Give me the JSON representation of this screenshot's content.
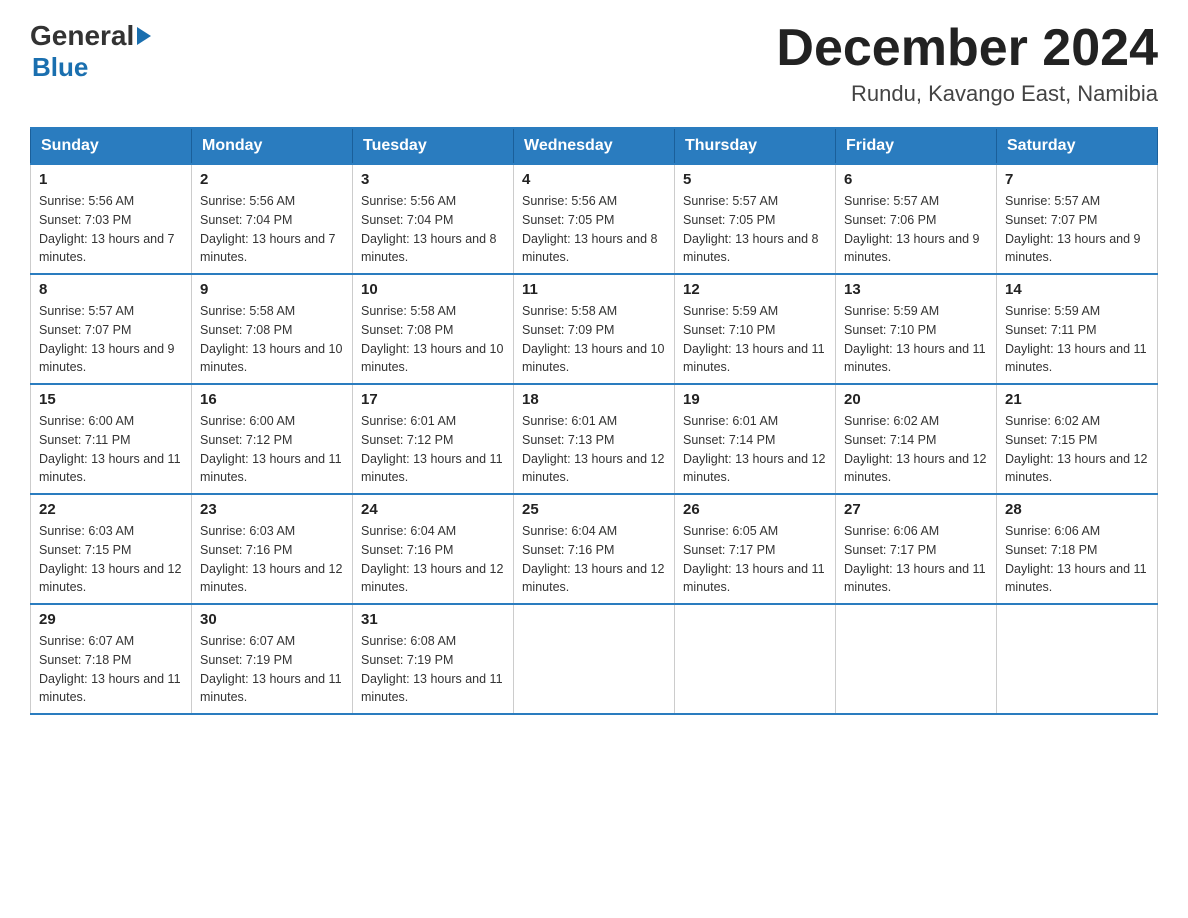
{
  "logo": {
    "general": "General",
    "blue": "Blue"
  },
  "title": {
    "month_year": "December 2024",
    "location": "Rundu, Kavango East, Namibia"
  },
  "weekdays": [
    "Sunday",
    "Monday",
    "Tuesday",
    "Wednesday",
    "Thursday",
    "Friday",
    "Saturday"
  ],
  "weeks": [
    [
      {
        "day": "1",
        "sunrise": "Sunrise: 5:56 AM",
        "sunset": "Sunset: 7:03 PM",
        "daylight": "Daylight: 13 hours and 7 minutes."
      },
      {
        "day": "2",
        "sunrise": "Sunrise: 5:56 AM",
        "sunset": "Sunset: 7:04 PM",
        "daylight": "Daylight: 13 hours and 7 minutes."
      },
      {
        "day": "3",
        "sunrise": "Sunrise: 5:56 AM",
        "sunset": "Sunset: 7:04 PM",
        "daylight": "Daylight: 13 hours and 8 minutes."
      },
      {
        "day": "4",
        "sunrise": "Sunrise: 5:56 AM",
        "sunset": "Sunset: 7:05 PM",
        "daylight": "Daylight: 13 hours and 8 minutes."
      },
      {
        "day": "5",
        "sunrise": "Sunrise: 5:57 AM",
        "sunset": "Sunset: 7:05 PM",
        "daylight": "Daylight: 13 hours and 8 minutes."
      },
      {
        "day": "6",
        "sunrise": "Sunrise: 5:57 AM",
        "sunset": "Sunset: 7:06 PM",
        "daylight": "Daylight: 13 hours and 9 minutes."
      },
      {
        "day": "7",
        "sunrise": "Sunrise: 5:57 AM",
        "sunset": "Sunset: 7:07 PM",
        "daylight": "Daylight: 13 hours and 9 minutes."
      }
    ],
    [
      {
        "day": "8",
        "sunrise": "Sunrise: 5:57 AM",
        "sunset": "Sunset: 7:07 PM",
        "daylight": "Daylight: 13 hours and 9 minutes."
      },
      {
        "day": "9",
        "sunrise": "Sunrise: 5:58 AM",
        "sunset": "Sunset: 7:08 PM",
        "daylight": "Daylight: 13 hours and 10 minutes."
      },
      {
        "day": "10",
        "sunrise": "Sunrise: 5:58 AM",
        "sunset": "Sunset: 7:08 PM",
        "daylight": "Daylight: 13 hours and 10 minutes."
      },
      {
        "day": "11",
        "sunrise": "Sunrise: 5:58 AM",
        "sunset": "Sunset: 7:09 PM",
        "daylight": "Daylight: 13 hours and 10 minutes."
      },
      {
        "day": "12",
        "sunrise": "Sunrise: 5:59 AM",
        "sunset": "Sunset: 7:10 PM",
        "daylight": "Daylight: 13 hours and 11 minutes."
      },
      {
        "day": "13",
        "sunrise": "Sunrise: 5:59 AM",
        "sunset": "Sunset: 7:10 PM",
        "daylight": "Daylight: 13 hours and 11 minutes."
      },
      {
        "day": "14",
        "sunrise": "Sunrise: 5:59 AM",
        "sunset": "Sunset: 7:11 PM",
        "daylight": "Daylight: 13 hours and 11 minutes."
      }
    ],
    [
      {
        "day": "15",
        "sunrise": "Sunrise: 6:00 AM",
        "sunset": "Sunset: 7:11 PM",
        "daylight": "Daylight: 13 hours and 11 minutes."
      },
      {
        "day": "16",
        "sunrise": "Sunrise: 6:00 AM",
        "sunset": "Sunset: 7:12 PM",
        "daylight": "Daylight: 13 hours and 11 minutes."
      },
      {
        "day": "17",
        "sunrise": "Sunrise: 6:01 AM",
        "sunset": "Sunset: 7:12 PM",
        "daylight": "Daylight: 13 hours and 11 minutes."
      },
      {
        "day": "18",
        "sunrise": "Sunrise: 6:01 AM",
        "sunset": "Sunset: 7:13 PM",
        "daylight": "Daylight: 13 hours and 12 minutes."
      },
      {
        "day": "19",
        "sunrise": "Sunrise: 6:01 AM",
        "sunset": "Sunset: 7:14 PM",
        "daylight": "Daylight: 13 hours and 12 minutes."
      },
      {
        "day": "20",
        "sunrise": "Sunrise: 6:02 AM",
        "sunset": "Sunset: 7:14 PM",
        "daylight": "Daylight: 13 hours and 12 minutes."
      },
      {
        "day": "21",
        "sunrise": "Sunrise: 6:02 AM",
        "sunset": "Sunset: 7:15 PM",
        "daylight": "Daylight: 13 hours and 12 minutes."
      }
    ],
    [
      {
        "day": "22",
        "sunrise": "Sunrise: 6:03 AM",
        "sunset": "Sunset: 7:15 PM",
        "daylight": "Daylight: 13 hours and 12 minutes."
      },
      {
        "day": "23",
        "sunrise": "Sunrise: 6:03 AM",
        "sunset": "Sunset: 7:16 PM",
        "daylight": "Daylight: 13 hours and 12 minutes."
      },
      {
        "day": "24",
        "sunrise": "Sunrise: 6:04 AM",
        "sunset": "Sunset: 7:16 PM",
        "daylight": "Daylight: 13 hours and 12 minutes."
      },
      {
        "day": "25",
        "sunrise": "Sunrise: 6:04 AM",
        "sunset": "Sunset: 7:16 PM",
        "daylight": "Daylight: 13 hours and 12 minutes."
      },
      {
        "day": "26",
        "sunrise": "Sunrise: 6:05 AM",
        "sunset": "Sunset: 7:17 PM",
        "daylight": "Daylight: 13 hours and 11 minutes."
      },
      {
        "day": "27",
        "sunrise": "Sunrise: 6:06 AM",
        "sunset": "Sunset: 7:17 PM",
        "daylight": "Daylight: 13 hours and 11 minutes."
      },
      {
        "day": "28",
        "sunrise": "Sunrise: 6:06 AM",
        "sunset": "Sunset: 7:18 PM",
        "daylight": "Daylight: 13 hours and 11 minutes."
      }
    ],
    [
      {
        "day": "29",
        "sunrise": "Sunrise: 6:07 AM",
        "sunset": "Sunset: 7:18 PM",
        "daylight": "Daylight: 13 hours and 11 minutes."
      },
      {
        "day": "30",
        "sunrise": "Sunrise: 6:07 AM",
        "sunset": "Sunset: 7:19 PM",
        "daylight": "Daylight: 13 hours and 11 minutes."
      },
      {
        "day": "31",
        "sunrise": "Sunrise: 6:08 AM",
        "sunset": "Sunset: 7:19 PM",
        "daylight": "Daylight: 13 hours and 11 minutes."
      },
      null,
      null,
      null,
      null
    ]
  ]
}
